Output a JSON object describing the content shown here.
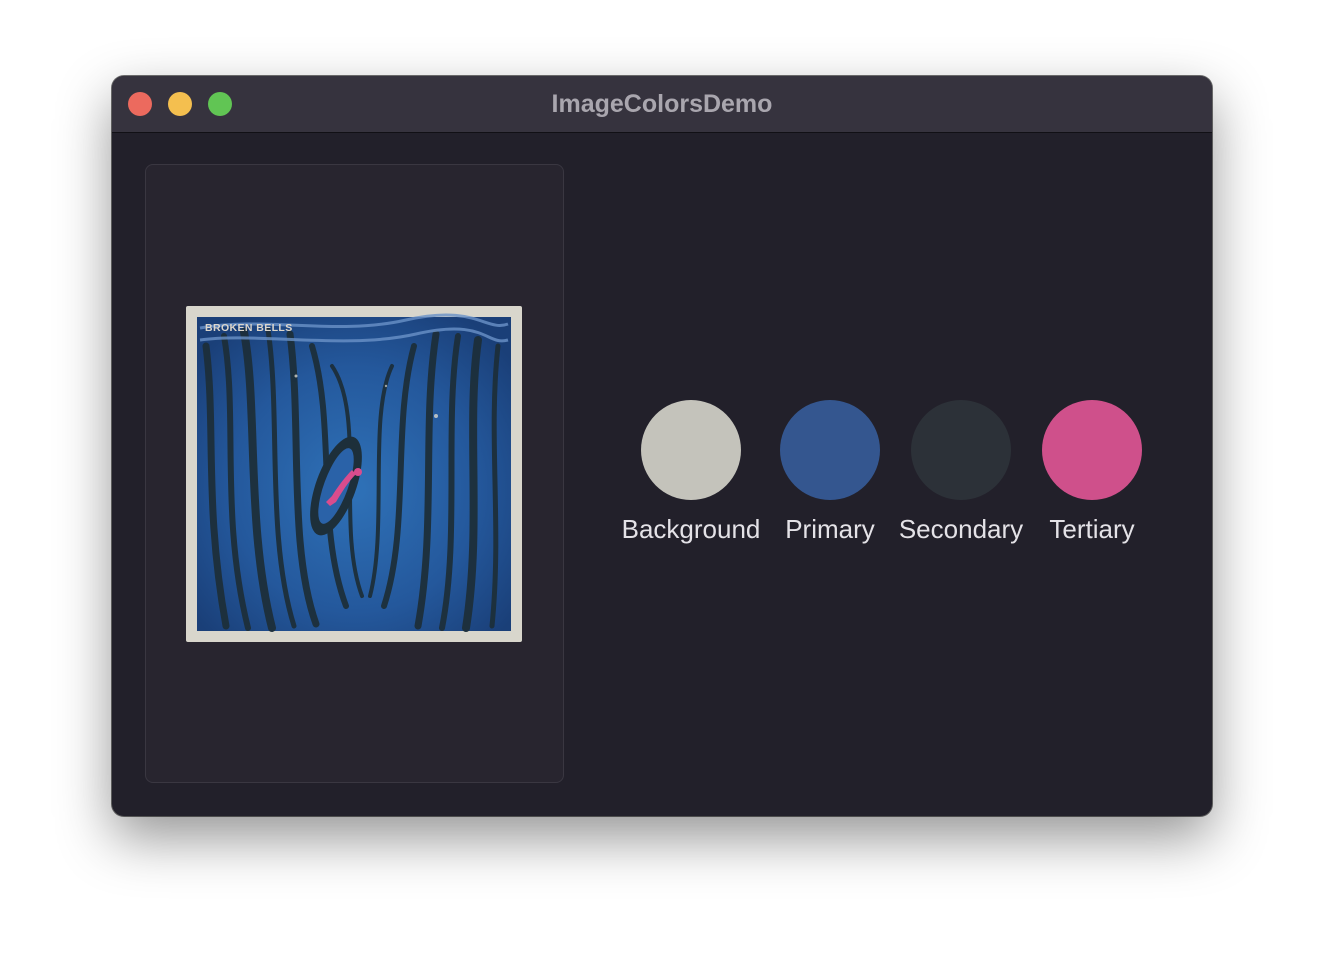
{
  "window": {
    "title": "ImageColorsDemo",
    "traffic_lights": {
      "close_color": "#ec6a5e",
      "minimize_color": "#f4bf4f",
      "zoom_color": "#61c554"
    }
  },
  "album": {
    "text": "BROKEN BELLS",
    "border_color": "#d8d6cc",
    "ink_color": "#2a6ab0",
    "figure_color": "#d94c8d"
  },
  "swatches": [
    {
      "label": "Background",
      "color": "#c4c3bb"
    },
    {
      "label": "Primary",
      "color": "#34568f"
    },
    {
      "label": "Secondary",
      "color": "#2c3138"
    },
    {
      "label": "Tertiary",
      "color": "#cf508b"
    }
  ]
}
